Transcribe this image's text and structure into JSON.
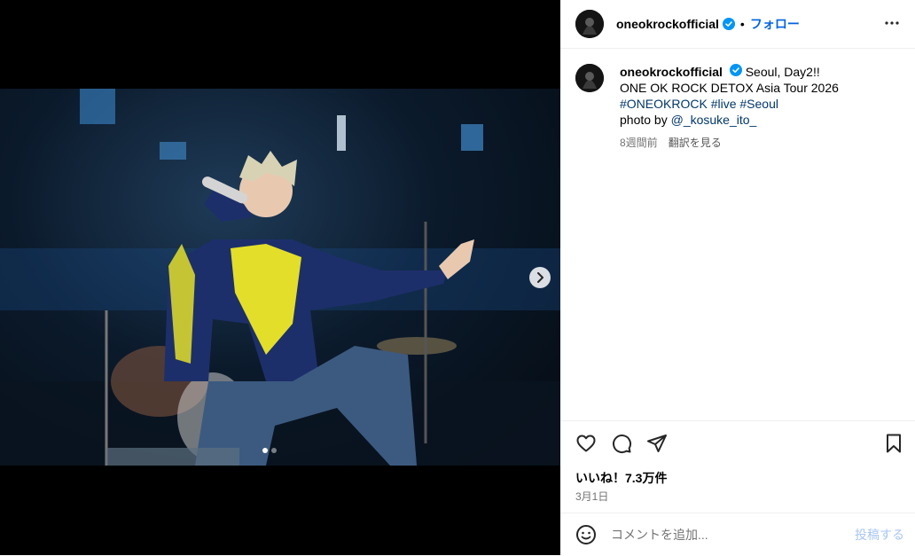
{
  "post": {
    "username": "oneokrockofficial",
    "follow_label": "フォロー",
    "separator": "•",
    "caption": {
      "line1": "Seoul, Day2!!",
      "line2": "ONE OK ROCK DETOX Asia Tour 2026",
      "hashtags": [
        "#ONEOKROCK",
        "#live",
        "#Seoul"
      ],
      "photo_by_label": "photo by",
      "photo_by_handle": "@_kosuke_ito_"
    },
    "time_ago": "8週間前",
    "translate_label": "翻訳を見る",
    "likes": "いいね！7.3万件",
    "date": "3月1日",
    "carousel": {
      "current": 1,
      "total": 2
    }
  },
  "comment": {
    "placeholder": "コメントを追加...",
    "post_label": "投稿する"
  },
  "icons": {
    "verified": "verified-badge-icon",
    "more": "more-options-icon",
    "like": "heart-icon",
    "comment": "comment-icon",
    "share": "share-icon",
    "save": "bookmark-icon",
    "emoji": "emoji-icon",
    "next": "chevron-right-icon"
  },
  "colors": {
    "accent": "#0064e0",
    "verified": "#0095f6",
    "link": "#00376b",
    "muted": "#737373"
  }
}
